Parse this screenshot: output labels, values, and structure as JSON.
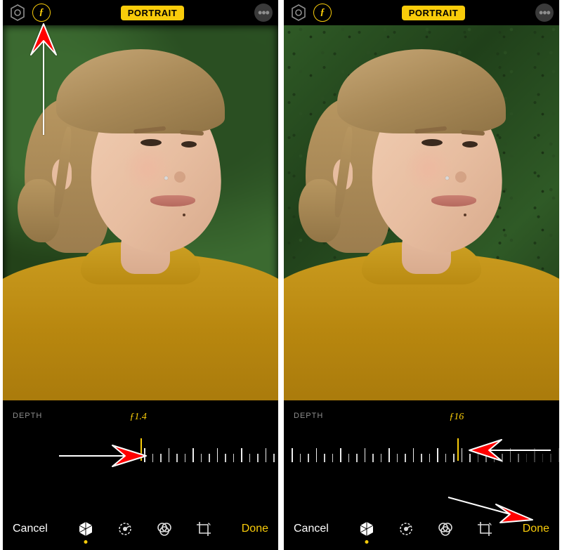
{
  "left": {
    "topbar": {
      "mode_label": "PORTRAIT",
      "f_glyph": "ƒ"
    },
    "depth": {
      "label": "DEPTH",
      "f_value": "ƒ1.4",
      "indicator_pct": 50,
      "value_left_pct": 46
    },
    "bottombar": {
      "cancel": "Cancel",
      "done": "Done"
    }
  },
  "right": {
    "topbar": {
      "mode_label": "PORTRAIT",
      "f_glyph": "ƒ"
    },
    "depth": {
      "label": "DEPTH",
      "f_value": "ƒ16",
      "indicator_pct": 78,
      "value_left_pct": 75
    },
    "bottombar": {
      "cancel": "Cancel",
      "done": "Done"
    }
  },
  "annotations": {
    "arrow_to_f_button": true,
    "arrow_to_left_slider": true,
    "arrow_to_right_slider": true,
    "arrow_to_done": true
  }
}
